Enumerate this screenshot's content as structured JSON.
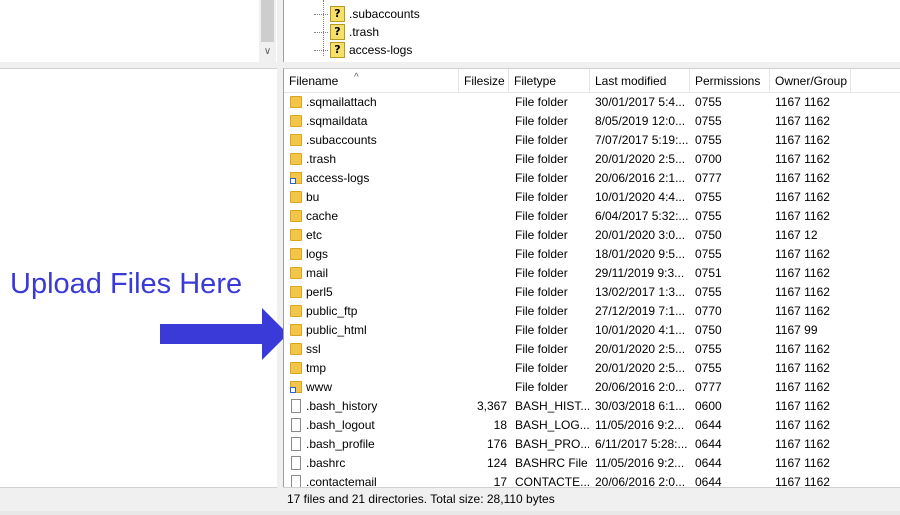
{
  "tree": {
    "items": [
      ".subaccounts",
      ".trash",
      "access-logs"
    ],
    "icon": "unknown-folder-icon"
  },
  "annotation": {
    "label": "Upload Files Here",
    "color": "#3a3ad8"
  },
  "listing": {
    "columns": {
      "filename": "Filename",
      "filesize": "Filesize",
      "filetype": "Filetype",
      "last_modified": "Last modified",
      "permissions": "Permissions",
      "owner_group": "Owner/Group"
    },
    "rows": [
      {
        "icon": "folder-icon",
        "name": ".sqmailattach",
        "size": "",
        "type": "File folder",
        "modified": "30/01/2017 5:4...",
        "perm": "0755",
        "owner": "1167 1162"
      },
      {
        "icon": "folder-icon",
        "name": ".sqmaildata",
        "size": "",
        "type": "File folder",
        "modified": "8/05/2019 12:0...",
        "perm": "0755",
        "owner": "1167 1162"
      },
      {
        "icon": "folder-icon",
        "name": ".subaccounts",
        "size": "",
        "type": "File folder",
        "modified": "7/07/2017 5:19:...",
        "perm": "0755",
        "owner": "1167 1162"
      },
      {
        "icon": "folder-icon",
        "name": ".trash",
        "size": "",
        "type": "File folder",
        "modified": "20/01/2020 2:5...",
        "perm": "0700",
        "owner": "1167 1162"
      },
      {
        "icon": "folder-link-icon",
        "name": "access-logs",
        "size": "",
        "type": "File folder",
        "modified": "20/06/2016 2:1...",
        "perm": "0777",
        "owner": "1167 1162"
      },
      {
        "icon": "folder-icon",
        "name": "bu",
        "size": "",
        "type": "File folder",
        "modified": "10/01/2020 4:4...",
        "perm": "0755",
        "owner": "1167 1162"
      },
      {
        "icon": "folder-icon",
        "name": "cache",
        "size": "",
        "type": "File folder",
        "modified": "6/04/2017 5:32:...",
        "perm": "0755",
        "owner": "1167 1162"
      },
      {
        "icon": "folder-icon",
        "name": "etc",
        "size": "",
        "type": "File folder",
        "modified": "20/01/2020 3:0...",
        "perm": "0750",
        "owner": "1167 12"
      },
      {
        "icon": "folder-icon",
        "name": "logs",
        "size": "",
        "type": "File folder",
        "modified": "18/01/2020 9:5...",
        "perm": "0755",
        "owner": "1167 1162"
      },
      {
        "icon": "folder-icon",
        "name": "mail",
        "size": "",
        "type": "File folder",
        "modified": "29/11/2019 9:3...",
        "perm": "0751",
        "owner": "1167 1162"
      },
      {
        "icon": "folder-icon",
        "name": "perl5",
        "size": "",
        "type": "File folder",
        "modified": "13/02/2017 1:3...",
        "perm": "0755",
        "owner": "1167 1162"
      },
      {
        "icon": "folder-icon",
        "name": "public_ftp",
        "size": "",
        "type": "File folder",
        "modified": "27/12/2019 7:1...",
        "perm": "0770",
        "owner": "1167 1162"
      },
      {
        "icon": "folder-icon",
        "name": "public_html",
        "size": "",
        "type": "File folder",
        "modified": "10/01/2020 4:1...",
        "perm": "0750",
        "owner": "1167 99"
      },
      {
        "icon": "folder-icon",
        "name": "ssl",
        "size": "",
        "type": "File folder",
        "modified": "20/01/2020 2:5...",
        "perm": "0755",
        "owner": "1167 1162"
      },
      {
        "icon": "folder-icon",
        "name": "tmp",
        "size": "",
        "type": "File folder",
        "modified": "20/01/2020 2:5...",
        "perm": "0755",
        "owner": "1167 1162"
      },
      {
        "icon": "folder-link-icon",
        "name": "www",
        "size": "",
        "type": "File folder",
        "modified": "20/06/2016 2:0...",
        "perm": "0777",
        "owner": "1167 1162"
      },
      {
        "icon": "file-icon",
        "name": ".bash_history",
        "size": "3,367",
        "type": "BASH_HIST...",
        "modified": "30/03/2018 6:1...",
        "perm": "0600",
        "owner": "1167 1162"
      },
      {
        "icon": "file-icon",
        "name": ".bash_logout",
        "size": "18",
        "type": "BASH_LOG...",
        "modified": "11/05/2016 9:2...",
        "perm": "0644",
        "owner": "1167 1162"
      },
      {
        "icon": "file-icon",
        "name": ".bash_profile",
        "size": "176",
        "type": "BASH_PRO...",
        "modified": "6/11/2017 5:28:...",
        "perm": "0644",
        "owner": "1167 1162"
      },
      {
        "icon": "file-icon",
        "name": ".bashrc",
        "size": "124",
        "type": "BASHRC File",
        "modified": "11/05/2016 9:2...",
        "perm": "0644",
        "owner": "1167 1162"
      },
      {
        "icon": "file-icon",
        "name": ".contactemail",
        "size": "17",
        "type": "CONTACTE...",
        "modified": "20/06/2016 2:0...",
        "perm": "0644",
        "owner": "1167 1162"
      }
    ]
  },
  "status": {
    "text": "17 files and 21 directories. Total size: 28,110 bytes"
  }
}
